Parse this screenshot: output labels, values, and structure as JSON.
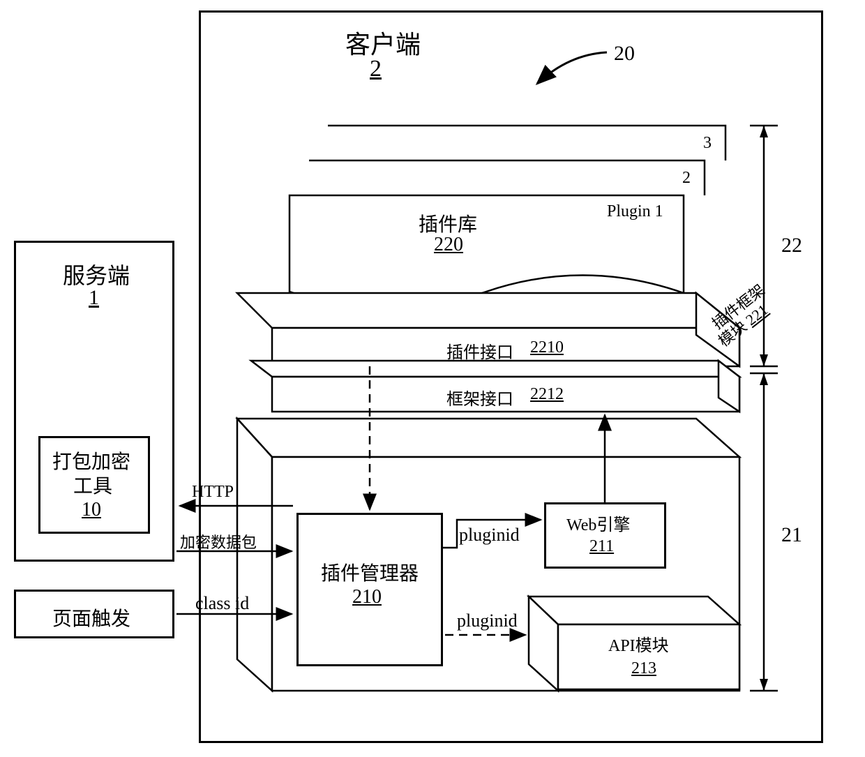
{
  "client": {
    "title": "客户端",
    "ref": "2",
    "system_ref": "20"
  },
  "server": {
    "title": "服务端",
    "ref": "1",
    "tool": {
      "title": "打包加密",
      "title2": "工具",
      "ref": "10"
    }
  },
  "page_trigger": "页面触发",
  "top_section": {
    "bracket_ref": "22",
    "plugin_library": {
      "title": "插件库",
      "ref": "220",
      "pages": {
        "p1": "Plugin 1",
        "p2": "2",
        "p3": "3"
      }
    },
    "framework_module": {
      "title": "插件框架",
      "title2": "模块",
      "ref": "221"
    },
    "plugin_interface": {
      "title": "插件接口",
      "ref": "2210"
    },
    "framework_interface": {
      "title": "框架接口",
      "ref": "2212"
    }
  },
  "bottom_section": {
    "bracket_ref": "21",
    "plugin_manager": {
      "title": "插件管理器",
      "ref": "210"
    },
    "web_engine": {
      "title": "Web引擎",
      "ref": "211"
    },
    "api_module": {
      "title": "API模块",
      "ref": "213"
    }
  },
  "connectors": {
    "http": "HTTP",
    "encrypted_packet": "加密数据包",
    "class_id": "class id",
    "pluginid1": "pluginid",
    "pluginid2": "pluginid"
  }
}
